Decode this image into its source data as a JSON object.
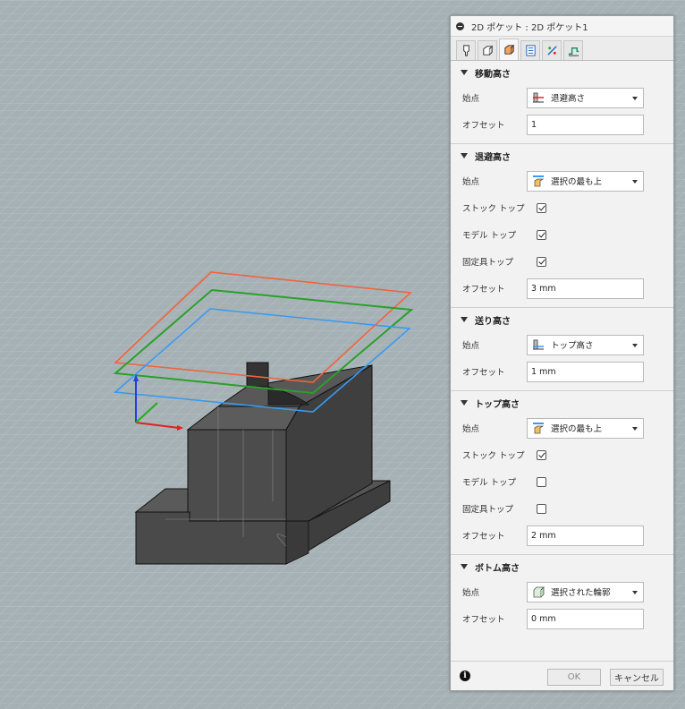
{
  "dialog": {
    "title": "2D ポケット : 2D ポケット1",
    "tabs": [
      "tool-icon",
      "geometry-icon",
      "heights-icon",
      "passes-icon",
      "linking-icon",
      "shapes-icon"
    ],
    "active_tab": 2
  },
  "sections": {
    "clearance": {
      "title": "移動高さ",
      "from_label": "始点",
      "from_value": "退避高さ",
      "offset_label": "オフセット",
      "offset_value": "1"
    },
    "retract": {
      "title": "退避高さ",
      "from_label": "始点",
      "from_value": "選択の最も上",
      "stock_top_label": "ストック トップ",
      "model_top_label": "モデル トップ",
      "fixture_top_label": "固定具トップ",
      "offset_label": "オフセット",
      "offset_value": "3 mm"
    },
    "feed": {
      "title": "送り高さ",
      "from_label": "始点",
      "from_value": "トップ高さ",
      "offset_label": "オフセット",
      "offset_value": "1 mm"
    },
    "top": {
      "title": "トップ高さ",
      "from_label": "始点",
      "from_value": "選択の最も上",
      "stock_top_label": "ストック トップ",
      "model_top_label": "モデル トップ",
      "fixture_top_label": "固定具トップ",
      "offset_label": "オフセット",
      "offset_value": "2 mm"
    },
    "bottom": {
      "title": "ボトム高さ",
      "from_label": "始点",
      "from_value": "選択された輪郭",
      "offset_label": "オフセット",
      "offset_value": "0 mm"
    }
  },
  "checkboxes": {
    "retract_stock_top": true,
    "retract_model_top": true,
    "retract_fixture_top": true,
    "top_stock_top": true,
    "top_model_top": false,
    "top_fixture_top": false
  },
  "footer": {
    "ok_label": "OK",
    "cancel_label": "キャンセル",
    "info_icon": "i"
  },
  "colors": {
    "clearance_plane": "#f0643c",
    "retract_plane": "#2aa02a",
    "feed_plane": "#3a9af0",
    "model": "#4a4a4a",
    "axis_x": "#e02020",
    "axis_y": "#20b020",
    "axis_z": "#2040e0"
  }
}
